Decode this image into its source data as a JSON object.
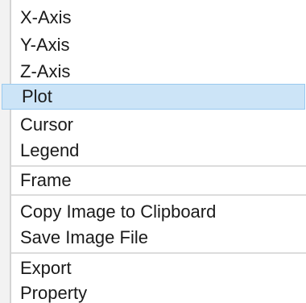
{
  "menu": {
    "items": [
      {
        "label": "X-Axis"
      },
      {
        "label": "Y-Axis"
      },
      {
        "label": "Z-Axis"
      },
      {
        "label": "Plot"
      },
      {
        "label": "Cursor"
      },
      {
        "label": "Legend"
      },
      {
        "label": "Frame"
      },
      {
        "label": "Copy Image to Clipboard"
      },
      {
        "label": "Save Image File"
      },
      {
        "label": "Export"
      },
      {
        "label": "Property"
      }
    ],
    "highlighted_item": "Plot",
    "highlight_color": "#cce4f7"
  }
}
